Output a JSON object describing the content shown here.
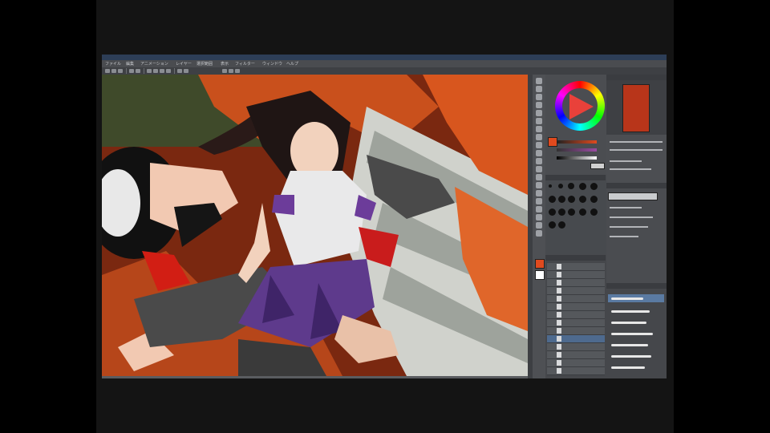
{
  "menu": [
    "ファイル",
    "編集",
    "アニメーション",
    "レイヤー",
    "選択範囲",
    "表示",
    "フィルター",
    "ウィンドウ",
    "ヘルプ"
  ],
  "panels": {
    "color_wheel": "color-wheel-icon",
    "navigator": "navigator-thumbnail",
    "brush_sizes": "brush-size-palette",
    "layers": "layer-list",
    "strokes": "stroke-presets"
  },
  "colors": {
    "accent": "#e04a1e",
    "canvas_bg": "#6a1e0c",
    "ui_dark": "#45474b",
    "selection": "#5a7aa2"
  }
}
